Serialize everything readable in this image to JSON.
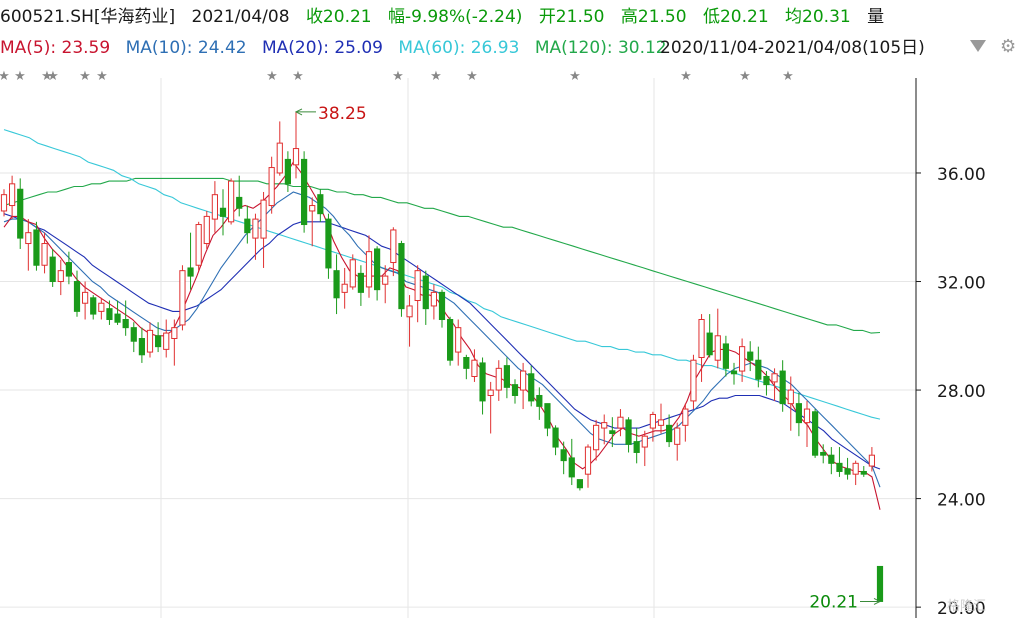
{
  "header": {
    "code": "600521.SH[华海药业]",
    "date": "2021/04/08",
    "close": "收20.21",
    "change": "幅-9.98%(-2.24)",
    "open": "开21.50",
    "high": "高21.50",
    "low": "低20.21",
    "avg": "均20.31",
    "vol": "量"
  },
  "ma_legend": {
    "ma5": "MA(5): 23.59",
    "ma10": "MA(10): 24.42",
    "ma20": "MA(20): 25.09",
    "ma60": "MA(60): 26.93",
    "ma120": "MA(120): 30.12",
    "range": "2020/11/04-2021/04/08(105日)"
  },
  "icons": {
    "dropdown": "chevron-down-icon",
    "settings": "gear-icon"
  },
  "watermark": "格隆汇",
  "colors": {
    "up": "#e03030",
    "down": "#1a9a1a",
    "ma5": "#c8142f",
    "ma10": "#2e6fb4",
    "ma20": "#1f2fb4",
    "ma60": "#38c8d8",
    "ma120": "#22a84a",
    "axis": "#1a1a1a",
    "grid": "#e6e6e6"
  },
  "chart_data": {
    "type": "candlestick",
    "title": "600521.SH[华海药业]",
    "y_ticks": [
      "36.00",
      "32.00",
      "28.00",
      "24.00",
      "20.00"
    ],
    "y_tick_values": [
      36,
      32,
      28,
      24,
      20
    ],
    "ylim": [
      19.6,
      39.5
    ],
    "num_days": 105,
    "date_range": [
      "2020/11/04",
      "2021/04/08"
    ],
    "max_label": "38.25",
    "max_value": 38.25,
    "min_label": "20.21",
    "min_value": 20.21,
    "last": {
      "open": 21.5,
      "high": 21.5,
      "low": 20.21,
      "close": 20.21
    },
    "candles": [
      [
        34.6,
        35.4,
        34.4,
        35.2
      ],
      [
        34.8,
        35.9,
        34.3,
        35.6
      ],
      [
        35.4,
        35.8,
        33.2,
        33.6
      ],
      [
        33.4,
        34.3,
        32.4,
        33.8
      ],
      [
        33.9,
        34.2,
        32.4,
        32.6
      ],
      [
        32.6,
        33.8,
        32.3,
        33.4
      ],
      [
        32.9,
        33.2,
        31.8,
        32.0
      ],
      [
        32.0,
        32.8,
        31.5,
        32.4
      ],
      [
        32.7,
        33.1,
        31.9,
        32.2
      ],
      [
        32.0,
        32.4,
        30.7,
        30.9
      ],
      [
        31.2,
        32.0,
        30.6,
        31.6
      ],
      [
        31.4,
        31.5,
        30.6,
        30.8
      ],
      [
        30.9,
        31.4,
        30.6,
        31.2
      ],
      [
        31.0,
        31.3,
        30.4,
        30.6
      ],
      [
        30.8,
        31.3,
        30.4,
        30.5
      ],
      [
        30.6,
        31.3,
        30.0,
        30.3
      ],
      [
        30.3,
        30.5,
        29.4,
        29.8
      ],
      [
        29.9,
        30.3,
        29.0,
        29.3
      ],
      [
        29.4,
        30.5,
        29.2,
        30.2
      ],
      [
        30.0,
        30.5,
        29.4,
        29.6
      ],
      [
        29.5,
        30.6,
        29.2,
        30.1
      ],
      [
        29.9,
        30.6,
        28.9,
        30.3
      ],
      [
        30.4,
        32.6,
        30.2,
        32.4
      ],
      [
        32.5,
        33.8,
        31.7,
        32.2
      ],
      [
        32.6,
        34.2,
        32.4,
        34.1
      ],
      [
        33.4,
        34.6,
        33.2,
        34.4
      ],
      [
        34.3,
        35.7,
        33.8,
        35.2
      ],
      [
        34.7,
        35.4,
        33.7,
        34.4
      ],
      [
        34.2,
        35.8,
        34.1,
        35.7
      ],
      [
        35.1,
        35.9,
        34.4,
        34.7
      ],
      [
        34.3,
        34.8,
        33.4,
        33.8
      ],
      [
        33.6,
        34.5,
        32.8,
        34.3
      ],
      [
        33.6,
        35.3,
        32.5,
        35.0
      ],
      [
        34.8,
        36.6,
        34.5,
        36.2
      ],
      [
        36.0,
        37.9,
        35.9,
        37.1
      ],
      [
        36.5,
        36.8,
        35.3,
        35.6
      ],
      [
        36.3,
        38.25,
        35.8,
        36.9
      ],
      [
        36.5,
        36.8,
        33.8,
        34.1
      ],
      [
        34.6,
        35.1,
        33.3,
        34.8
      ],
      [
        35.2,
        35.4,
        34.2,
        34.5
      ],
      [
        34.3,
        34.5,
        32.1,
        32.5
      ],
      [
        32.4,
        33.0,
        30.8,
        31.4
      ],
      [
        31.6,
        32.5,
        31.0,
        31.9
      ],
      [
        31.8,
        33.0,
        31.7,
        32.8
      ],
      [
        32.3,
        32.6,
        31.1,
        31.6
      ],
      [
        31.8,
        33.7,
        31.4,
        33.1
      ],
      [
        33.2,
        33.3,
        31.3,
        31.7
      ],
      [
        31.9,
        32.6,
        31.2,
        32.2
      ],
      [
        32.7,
        34.0,
        32.2,
        33.9
      ],
      [
        33.4,
        33.5,
        30.7,
        31.0
      ],
      [
        30.7,
        31.5,
        29.6,
        31.1
      ],
      [
        31.3,
        32.6,
        30.5,
        32.4
      ],
      [
        32.2,
        32.4,
        30.4,
        31.0
      ],
      [
        31.1,
        31.9,
        30.6,
        31.6
      ],
      [
        31.6,
        31.7,
        30.3,
        30.6
      ],
      [
        30.6,
        30.7,
        28.9,
        29.1
      ],
      [
        29.4,
        30.6,
        28.9,
        30.3
      ],
      [
        29.2,
        29.3,
        28.4,
        28.8
      ],
      [
        28.5,
        29.5,
        28.3,
        29.1
      ],
      [
        29.0,
        29.2,
        27.1,
        27.6
      ],
      [
        27.8,
        28.3,
        26.4,
        28.0
      ],
      [
        28.0,
        29.1,
        27.6,
        28.8
      ],
      [
        28.9,
        29.2,
        27.7,
        28.1
      ],
      [
        28.2,
        28.4,
        27.5,
        27.8
      ],
      [
        28.0,
        29.0,
        27.3,
        28.7
      ],
      [
        28.6,
        28.9,
        27.4,
        27.6
      ],
      [
        27.8,
        28.1,
        26.9,
        27.4
      ],
      [
        27.5,
        27.5,
        26.3,
        26.6
      ],
      [
        26.6,
        26.7,
        25.6,
        25.9
      ],
      [
        25.8,
        26.1,
        24.9,
        25.4
      ],
      [
        25.5,
        26.2,
        24.5,
        24.8
      ],
      [
        24.7,
        24.7,
        24.3,
        24.4
      ],
      [
        24.9,
        26.0,
        24.4,
        25.9
      ],
      [
        25.8,
        26.9,
        25.4,
        26.7
      ],
      [
        26.6,
        27.1,
        26.0,
        26.8
      ],
      [
        26.5,
        27.0,
        25.9,
        26.4
      ],
      [
        26.6,
        27.3,
        26.3,
        27.0
      ],
      [
        26.9,
        27.0,
        25.7,
        26.0
      ],
      [
        26.1,
        26.6,
        25.3,
        25.7
      ],
      [
        25.9,
        26.5,
        25.2,
        26.3
      ],
      [
        26.6,
        27.2,
        26.1,
        27.1
      ],
      [
        26.7,
        27.5,
        26.4,
        26.9
      ],
      [
        26.7,
        27.1,
        25.9,
        26.1
      ],
      [
        26.0,
        26.8,
        25.4,
        26.6
      ],
      [
        26.7,
        27.5,
        26.1,
        27.3
      ],
      [
        27.6,
        29.3,
        27.3,
        29.1
      ],
      [
        29.2,
        30.8,
        28.3,
        30.6
      ],
      [
        30.1,
        30.8,
        29.2,
        29.3
      ],
      [
        29.1,
        31.0,
        28.8,
        30.0
      ],
      [
        29.7,
        30.0,
        28.5,
        28.8
      ],
      [
        28.7,
        29.0,
        28.2,
        28.6
      ],
      [
        28.7,
        29.9,
        28.3,
        29.6
      ],
      [
        29.4,
        29.8,
        28.7,
        29.1
      ],
      [
        29.1,
        29.6,
        28.1,
        28.4
      ],
      [
        28.5,
        28.7,
        27.8,
        28.2
      ],
      [
        28.3,
        28.8,
        27.6,
        28.6
      ],
      [
        28.7,
        29.1,
        27.2,
        27.5
      ],
      [
        27.5,
        28.5,
        26.5,
        28.0
      ],
      [
        27.5,
        27.9,
        26.3,
        26.8
      ],
      [
        26.8,
        27.6,
        25.9,
        27.3
      ],
      [
        27.2,
        27.3,
        25.5,
        25.6
      ],
      [
        25.7,
        26.0,
        25.3,
        25.6
      ],
      [
        25.6,
        25.9,
        24.9,
        25.3
      ],
      [
        25.3,
        25.9,
        24.8,
        25.0
      ],
      [
        25.1,
        25.5,
        24.7,
        24.9
      ],
      [
        24.9,
        25.4,
        24.5,
        25.3
      ],
      [
        25.0,
        25.2,
        24.8,
        24.9
      ],
      [
        25.2,
        25.9,
        25.0,
        25.6
      ]
    ],
    "ma5": [
      34.0,
      34.4,
      34.4,
      34.2,
      34.1,
      33.6,
      33.2,
      32.9,
      32.5,
      32.1,
      31.8,
      31.6,
      31.4,
      31.2,
      31.0,
      30.8,
      30.6,
      30.3,
      30.1,
      30.0,
      30.0,
      30.2,
      30.8,
      31.5,
      32.2,
      33.0,
      33.7,
      34.0,
      34.4,
      34.7,
      34.8,
      34.7,
      34.9,
      35.2,
      35.5,
      35.9,
      36.4,
      36.0,
      35.5,
      35.0,
      34.3,
      33.5,
      32.9,
      32.4,
      32.2,
      32.2,
      32.2,
      32.2,
      32.5,
      32.4,
      31.8,
      31.7,
      31.5,
      31.5,
      31.3,
      30.8,
      30.4,
      29.9,
      29.5,
      28.9,
      28.6,
      28.5,
      28.4,
      28.2,
      28.1,
      28.0,
      27.7,
      27.3,
      26.8,
      26.2,
      25.8,
      25.3,
      25.1,
      25.3,
      25.6,
      26.0,
      26.4,
      26.6,
      26.4,
      26.3,
      26.4,
      26.5,
      26.5,
      26.6,
      27.0,
      27.6,
      28.4,
      28.9,
      29.4,
      29.5,
      29.5,
      29.4,
      29.2,
      29.0,
      28.8,
      28.5,
      28.1,
      27.8,
      27.5,
      27.0,
      26.7,
      26.2,
      25.8,
      25.4,
      25.2,
      25.1,
      25.0,
      25.0,
      24.8,
      23.59
    ],
    "ma10": [
      34.2,
      34.3,
      34.3,
      34.2,
      34.0,
      33.8,
      33.5,
      33.2,
      32.9,
      32.6,
      32.3,
      32.0,
      31.8,
      31.5,
      31.3,
      31.1,
      30.9,
      30.7,
      30.5,
      30.3,
      30.2,
      30.2,
      30.4,
      30.6,
      31.0,
      31.5,
      32.0,
      32.5,
      32.9,
      33.3,
      33.7,
      34.0,
      34.3,
      34.6,
      34.9,
      35.1,
      35.3,
      35.2,
      35.1,
      34.9,
      34.7,
      34.4,
      34.0,
      33.7,
      33.3,
      33.0,
      32.7,
      32.5,
      32.4,
      32.3,
      32.0,
      31.9,
      31.8,
      31.7,
      31.6,
      31.4,
      31.2,
      30.9,
      30.6,
      30.3,
      30.0,
      29.7,
      29.4,
      29.1,
      28.8,
      28.6,
      28.4,
      28.2,
      27.9,
      27.6,
      27.3,
      27.0,
      26.7,
      26.4,
      26.2,
      26.1,
      26.0,
      26.0,
      26.0,
      26.1,
      26.2,
      26.3,
      26.4,
      26.5,
      26.7,
      27.0,
      27.3,
      27.6,
      28.0,
      28.3,
      28.6,
      28.8,
      28.9,
      29.0,
      28.9,
      28.8,
      28.6,
      28.4,
      28.2,
      27.9,
      27.6,
      27.3,
      27.0,
      26.7,
      26.4,
      26.1,
      25.8,
      25.5,
      25.2,
      24.42
    ],
    "ma20": [
      34.5,
      34.4,
      34.3,
      34.2,
      34.0,
      33.9,
      33.7,
      33.5,
      33.3,
      33.1,
      32.9,
      32.6,
      32.4,
      32.2,
      32.0,
      31.8,
      31.6,
      31.4,
      31.2,
      31.1,
      31.0,
      30.9,
      30.9,
      31.0,
      31.1,
      31.3,
      31.5,
      31.7,
      32.0,
      32.3,
      32.6,
      32.9,
      33.2,
      33.4,
      33.7,
      33.9,
      34.1,
      34.2,
      34.2,
      34.2,
      34.2,
      34.1,
      34.0,
      33.9,
      33.8,
      33.7,
      33.5,
      33.3,
      33.2,
      33.0,
      32.8,
      32.6,
      32.4,
      32.2,
      32.0,
      31.8,
      31.6,
      31.4,
      31.2,
      30.9,
      30.6,
      30.3,
      30.0,
      29.7,
      29.4,
      29.1,
      28.8,
      28.5,
      28.2,
      27.9,
      27.6,
      27.3,
      27.1,
      26.9,
      26.8,
      26.7,
      26.6,
      26.6,
      26.6,
      26.6,
      26.7,
      26.8,
      26.9,
      27.0,
      27.1,
      27.2,
      27.3,
      27.4,
      27.6,
      27.7,
      27.7,
      27.8,
      27.8,
      27.8,
      27.8,
      27.7,
      27.6,
      27.5,
      27.3,
      27.1,
      26.9,
      26.7,
      26.5,
      26.2,
      26.0,
      25.8,
      25.6,
      25.4,
      25.2,
      25.09
    ],
    "ma60": [
      37.6,
      37.5,
      37.4,
      37.3,
      37.1,
      37.0,
      36.9,
      36.8,
      36.7,
      36.6,
      36.4,
      36.3,
      36.2,
      36.1,
      35.9,
      35.8,
      35.6,
      35.5,
      35.4,
      35.2,
      35.1,
      34.9,
      34.8,
      34.7,
      34.6,
      34.5,
      34.4,
      34.3,
      34.2,
      34.1,
      34.0,
      33.9,
      33.8,
      33.7,
      33.6,
      33.5,
      33.4,
      33.3,
      33.2,
      33.1,
      33.0,
      32.9,
      32.8,
      32.7,
      32.6,
      32.5,
      32.4,
      32.3,
      32.2,
      32.1,
      32.0,
      31.9,
      31.8,
      31.6,
      31.5,
      31.3,
      31.2,
      31.0,
      30.9,
      30.7,
      30.6,
      30.5,
      30.4,
      30.3,
      30.2,
      30.1,
      30.0,
      29.9,
      29.8,
      29.8,
      29.7,
      29.6,
      29.6,
      29.5,
      29.5,
      29.4,
      29.4,
      29.3,
      29.3,
      29.2,
      29.1,
      29.1,
      29.0,
      28.9,
      28.9,
      28.8,
      28.7,
      28.6,
      28.5,
      28.4,
      28.3,
      28.2,
      28.1,
      28.0,
      27.9,
      27.8,
      27.7,
      27.6,
      27.5,
      27.4,
      27.3,
      27.2,
      27.1,
      27.0,
      26.93
    ],
    "ma120": [
      34.8,
      34.9,
      35.0,
      35.1,
      35.2,
      35.3,
      35.3,
      35.4,
      35.5,
      35.5,
      35.6,
      35.6,
      35.7,
      35.7,
      35.7,
      35.8,
      35.8,
      35.8,
      35.8,
      35.8,
      35.8,
      35.8,
      35.8,
      35.8,
      35.8,
      35.8,
      35.7,
      35.7,
      35.7,
      35.7,
      35.6,
      35.6,
      35.6,
      35.5,
      35.5,
      35.5,
      35.4,
      35.4,
      35.3,
      35.3,
      35.2,
      35.2,
      35.1,
      35.1,
      35.0,
      34.9,
      34.9,
      34.8,
      34.7,
      34.7,
      34.6,
      34.5,
      34.4,
      34.4,
      34.3,
      34.2,
      34.1,
      34.0,
      34.0,
      33.9,
      33.8,
      33.7,
      33.6,
      33.5,
      33.4,
      33.3,
      33.2,
      33.1,
      33.0,
      32.9,
      32.8,
      32.7,
      32.6,
      32.5,
      32.4,
      32.3,
      32.2,
      32.1,
      32.0,
      31.9,
      31.8,
      31.7,
      31.6,
      31.5,
      31.4,
      31.3,
      31.2,
      31.1,
      31.0,
      30.9,
      30.8,
      30.7,
      30.6,
      30.5,
      30.4,
      30.4,
      30.3,
      30.2,
      30.2,
      30.1,
      30.12
    ]
  }
}
